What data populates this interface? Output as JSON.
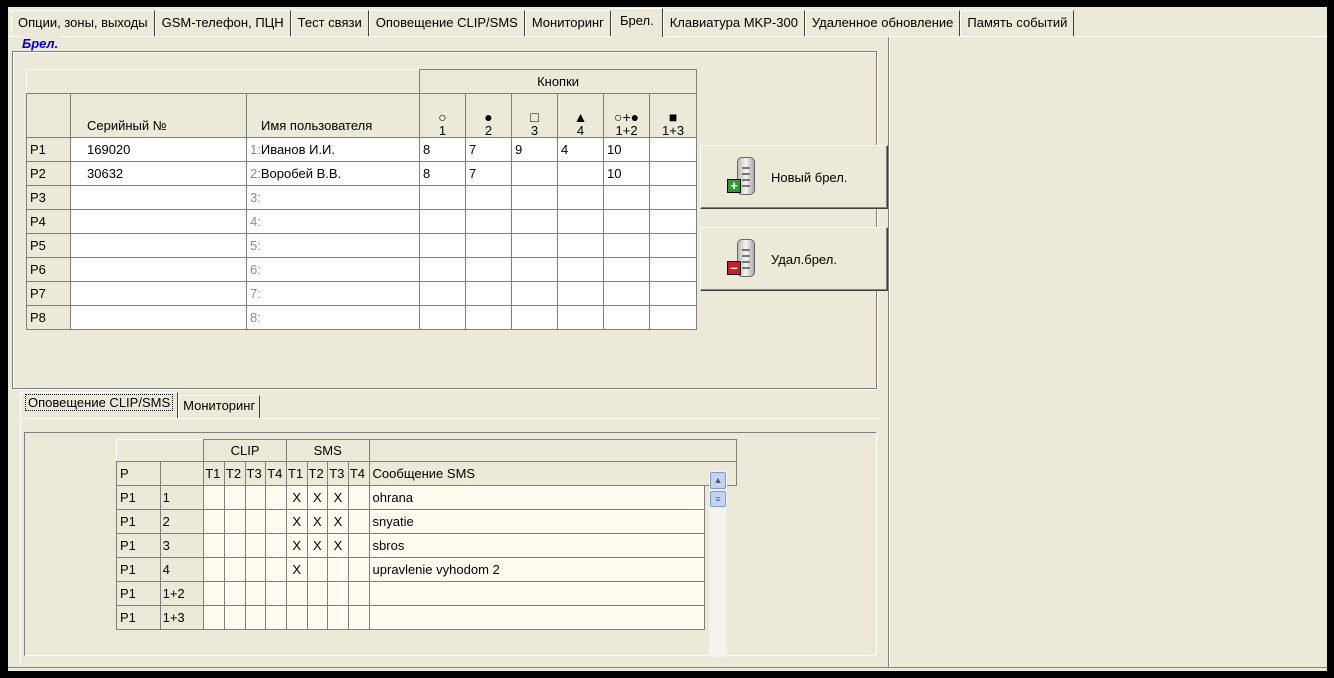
{
  "tabs": [
    "Опции, зоны, выходы",
    "GSM-телефон, ПЦН",
    "Тест связи",
    "Оповещение CLIP/SMS",
    "Мониторинг",
    "Брел.",
    "Клавиатура MKP-300",
    "Удаленное обновление",
    "Память событий"
  ],
  "active_tab": "Брел.",
  "group": {
    "title": "Брел."
  },
  "fob_table": {
    "buttons_header": "Кнопки",
    "col_serial": "Серийный №",
    "col_user": "Имя пользователя",
    "button_cols": [
      {
        "symbol": "○",
        "label": "1"
      },
      {
        "symbol": "●",
        "label": "2"
      },
      {
        "symbol": "□",
        "label": "3"
      },
      {
        "symbol": "▲",
        "label": "4"
      },
      {
        "symbol": "○+●",
        "label": "1+2"
      },
      {
        "symbol": "■",
        "label": "1+3"
      }
    ],
    "rows": [
      {
        "id": "P1",
        "serial": "169020",
        "num": "1:",
        "user": "Иванов И.И.",
        "b": [
          "8",
          "7",
          "9",
          "4",
          "10",
          ""
        ]
      },
      {
        "id": "P2",
        "serial": "30632",
        "num": "2:",
        "user": "Воробей В.В.",
        "b": [
          "8",
          "7",
          "",
          "",
          "10",
          ""
        ]
      },
      {
        "id": "P3",
        "serial": "",
        "num": "3:",
        "user": "",
        "b": [
          "",
          "",
          "",
          "",
          "",
          ""
        ]
      },
      {
        "id": "P4",
        "serial": "",
        "num": "4:",
        "user": "",
        "b": [
          "",
          "",
          "",
          "",
          "",
          ""
        ]
      },
      {
        "id": "P5",
        "serial": "",
        "num": "5:",
        "user": "",
        "b": [
          "",
          "",
          "",
          "",
          "",
          ""
        ]
      },
      {
        "id": "P6",
        "serial": "",
        "num": "6:",
        "user": "",
        "b": [
          "",
          "",
          "",
          "",
          "",
          ""
        ]
      },
      {
        "id": "P7",
        "serial": "",
        "num": "7:",
        "user": "",
        "b": [
          "",
          "",
          "",
          "",
          "",
          ""
        ]
      },
      {
        "id": "P8",
        "serial": "",
        "num": "8:",
        "user": "",
        "b": [
          "",
          "",
          "",
          "",
          "",
          ""
        ]
      }
    ]
  },
  "buttons": {
    "new_fob": "Новый брел.",
    "delete_fob": "Удал.брел."
  },
  "subtabs": [
    "Оповещение CLIP/SMS",
    "Мониторинг"
  ],
  "notify_table": {
    "clip_header": "CLIP",
    "sms_header": "SMS",
    "col_p": "P",
    "t_cols": [
      "T1",
      "T2",
      "T3",
      "T4"
    ],
    "col_message": "Сообщение SMS",
    "rows": [
      {
        "p": "P1",
        "btn": "1",
        "clip": [
          "",
          "",
          "",
          ""
        ],
        "sms": [
          "X",
          "X",
          "X",
          ""
        ],
        "msg": "ohrana"
      },
      {
        "p": "P1",
        "btn": "2",
        "clip": [
          "",
          "",
          "",
          ""
        ],
        "sms": [
          "X",
          "X",
          "X",
          ""
        ],
        "msg": "snyatie"
      },
      {
        "p": "P1",
        "btn": "3",
        "clip": [
          "",
          "",
          "",
          ""
        ],
        "sms": [
          "X",
          "X",
          "X",
          ""
        ],
        "msg": "sbros"
      },
      {
        "p": "P1",
        "btn": "4",
        "clip": [
          "",
          "",
          "",
          ""
        ],
        "sms": [
          "X",
          "",
          "",
          ""
        ],
        "msg": "upravlenie vyhodom 2"
      },
      {
        "p": "P1",
        "btn": "1+2",
        "clip": [
          "",
          "",
          "",
          ""
        ],
        "sms": [
          "",
          "",
          "",
          ""
        ],
        "msg": ""
      },
      {
        "p": "P1",
        "btn": "1+3",
        "clip": [
          "",
          "",
          "",
          ""
        ],
        "sms": [
          "",
          "",
          "",
          ""
        ],
        "msg": ""
      }
    ]
  },
  "colors": {
    "face": "#ece9d8",
    "title_blue": "#0000cc",
    "new_badge": "#2f9a2f",
    "del_badge": "#cc2020"
  }
}
